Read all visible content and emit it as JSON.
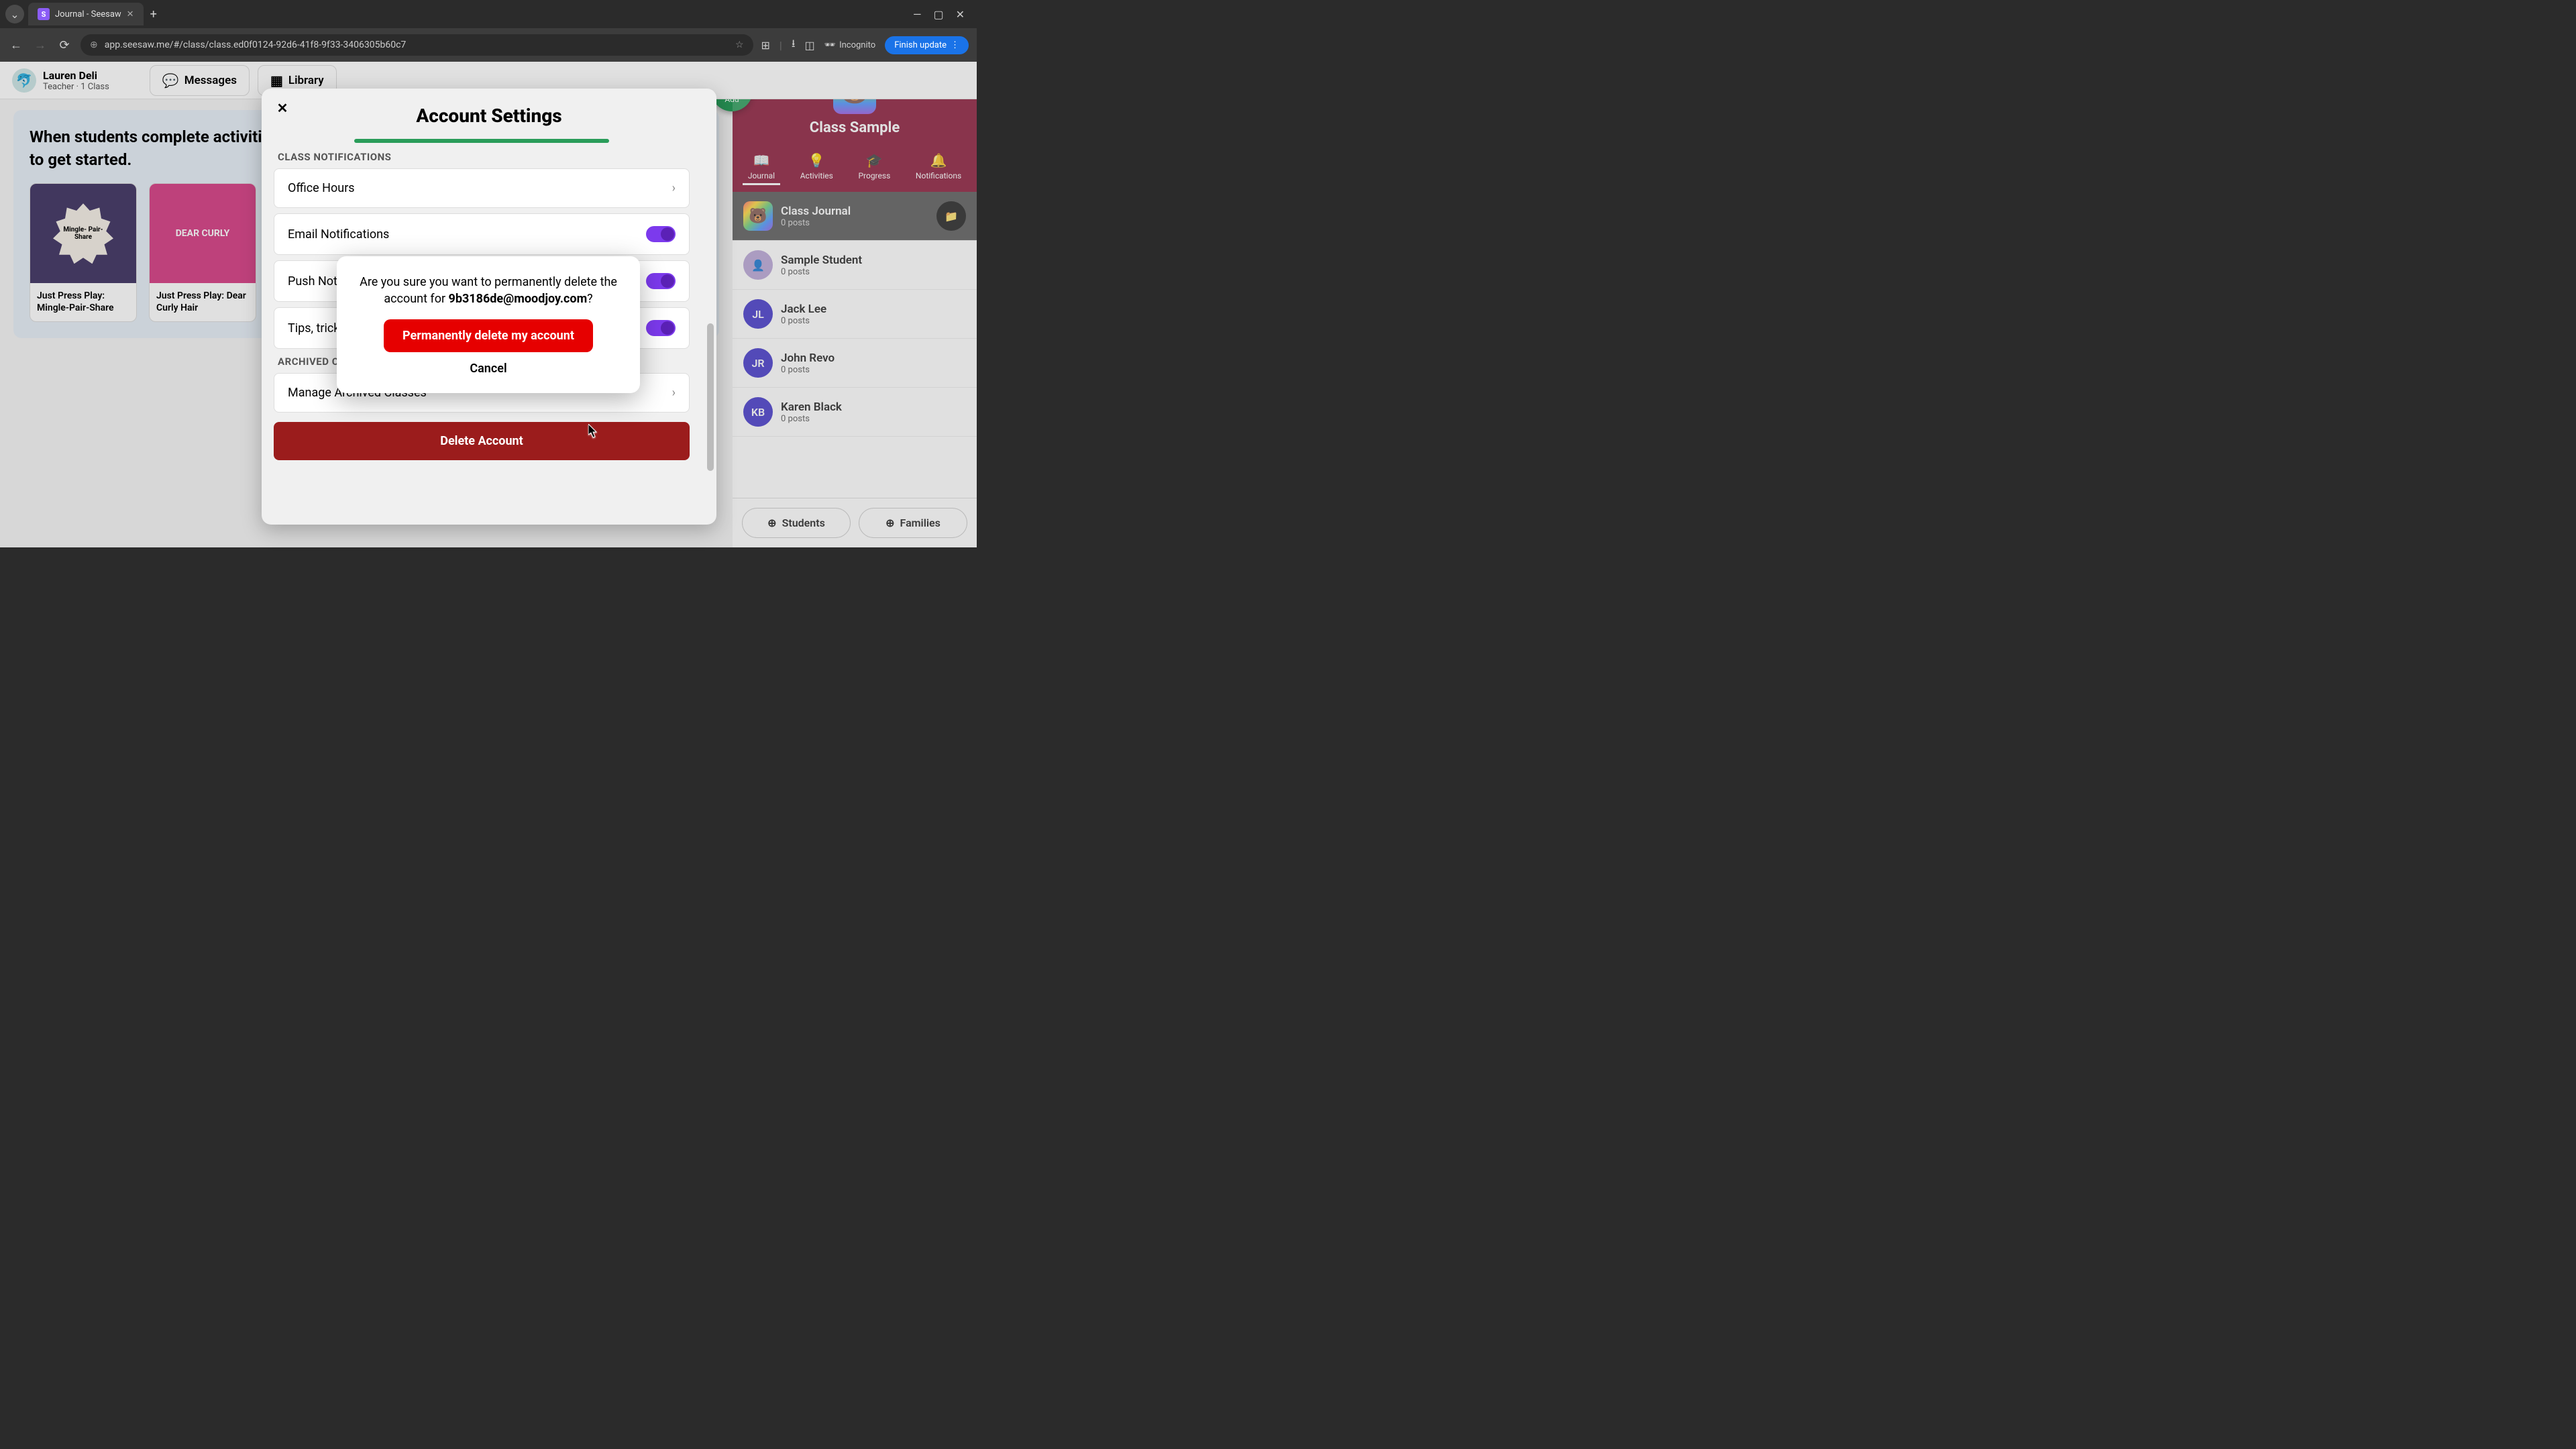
{
  "browser": {
    "tab_title": "Journal - Seesaw",
    "url": "app.seesaw.me/#/class/class.ed0f0124-92d6-41f8-9f33-3406305b60c7",
    "incognito_label": "Incognito",
    "finish_update": "Finish update"
  },
  "topbar": {
    "user_name": "Lauren Deli",
    "user_role": "Teacher · 1 Class",
    "messages": "Messages",
    "library": "Library"
  },
  "journal": {
    "heading": "When students complete activities, their work appears in the Journal. Explore these activities to get started.",
    "cards": [
      {
        "title": "Just Press Play: Mingle-Pair-Share",
        "badge": "Mingle-\nPair-\nShare"
      },
      {
        "title": "Just Press Play: Dear Curly Hair",
        "badge": "DEAR CURLY"
      }
    ]
  },
  "sidebar": {
    "add_label": "Add",
    "class_name": "Class Sample",
    "tabs": {
      "journal": "Journal",
      "activities": "Activities",
      "progress": "Progress",
      "notifications": "Notifications"
    },
    "items": [
      {
        "title": "Class Journal",
        "sub": "0 posts",
        "avatar": "🐻",
        "color": "rainbow"
      },
      {
        "title": "Sample Student",
        "sub": "0 posts",
        "avatar": "",
        "color": "#b9a5d6"
      },
      {
        "title": "Jack Lee",
        "sub": "0 posts",
        "avatar": "JL",
        "color": "#4338ca"
      },
      {
        "title": "John Revo",
        "sub": "0 posts",
        "avatar": "JR",
        "color": "#4338ca"
      },
      {
        "title": "Karen Black",
        "sub": "0 posts",
        "avatar": "KB",
        "color": "#4338ca"
      }
    ],
    "footer": {
      "students": "Students",
      "families": "Families"
    }
  },
  "settings": {
    "title": "Account Settings",
    "section_notifications": "CLASS NOTIFICATIONS",
    "office_hours": "Office Hours",
    "email_notifications": "Email Notifications",
    "push_notifications": "Push Notifications",
    "tips": "Tips, tricks, and product updates",
    "section_archived": "ARCHIVED CLASSES",
    "manage_archived": "Manage Archived Classes",
    "delete_account": "Delete Account"
  },
  "confirm": {
    "msg_prefix": "Are you sure you want to permanently delete the account for ",
    "email": "9b3186de@moodjoy.com",
    "msg_suffix": "?",
    "delete_btn": "Permanently delete my account",
    "cancel": "Cancel"
  }
}
